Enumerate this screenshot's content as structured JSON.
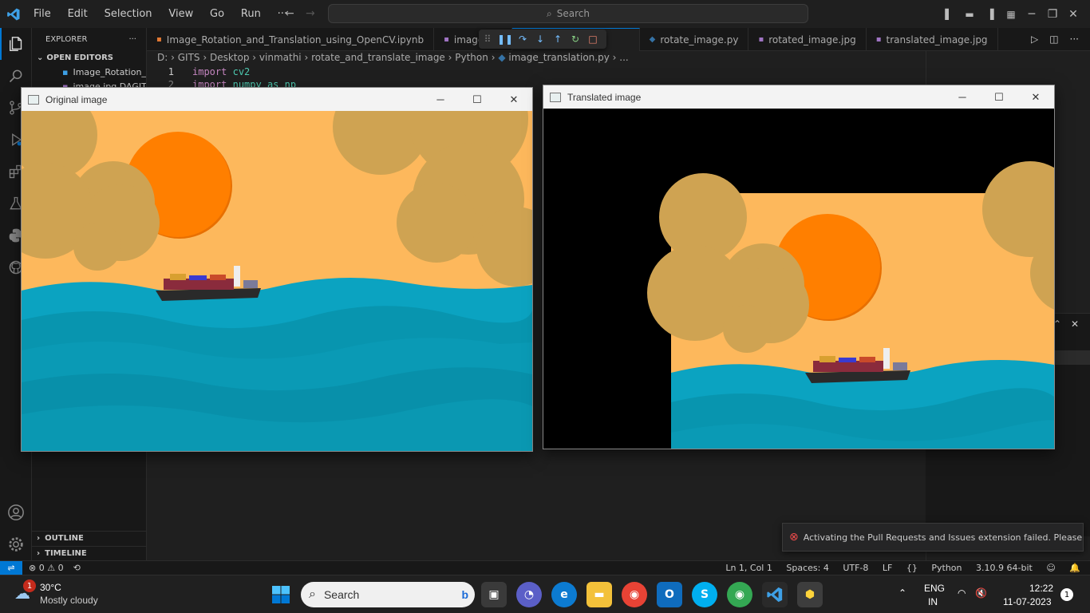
{
  "menu": {
    "items": [
      "File",
      "Edit",
      "Selection",
      "View",
      "Go",
      "Run",
      "···"
    ]
  },
  "command_center": {
    "label": "Search"
  },
  "sidebar": {
    "title": "EXPLORER",
    "open_editors": "OPEN EDITORS",
    "files": [
      "Image_Rotation_...",
      "image.jpg DAGIT..."
    ],
    "outline": "OUTLINE",
    "timeline": "TIMELINE"
  },
  "tabs": [
    {
      "label": "Image_Rotation_and_Translation_using_OpenCV.ipynb",
      "icon_color": "#e37933"
    },
    {
      "label": "image.jpg",
      "icon_color": "#a074c4"
    },
    {
      "label": "rotate_image.py",
      "icon_color": "#3572a5"
    },
    {
      "label": "rotated_image.jpg",
      "icon_color": "#a074c4"
    },
    {
      "label": "translated_image.jpg",
      "icon_color": "#a074c4"
    }
  ],
  "breadcrumb": [
    "D:",
    "GITS",
    "Desktop",
    "vinmathi",
    "rotate_and_translate_image",
    "Python",
    "image_translation.py",
    "..."
  ],
  "editor": {
    "lines": [
      {
        "num": "1",
        "kw": "import",
        "mod": "cv2"
      },
      {
        "num": "2",
        "kw": "import",
        "mod": "numpy as np"
      }
    ]
  },
  "windows": {
    "original": {
      "title": "Original image"
    },
    "translated": {
      "title": "Translated image"
    }
  },
  "status": {
    "errors": "0",
    "warnings": "0",
    "position": "Ln 1, Col 1",
    "spaces": "Spaces: 4",
    "encoding": "UTF-8",
    "eol": "LF",
    "language": "Python",
    "interpreter": "3.10.9 64-bit"
  },
  "notification": {
    "text": "Activating the Pull Requests and Issues extension failed. Please make s..."
  },
  "taskbar": {
    "weather_temp": "30°C",
    "weather_desc": "Mostly cloudy",
    "weather_badge": "1",
    "search": "Search",
    "lang1": "ENG",
    "lang2": "IN",
    "time": "12:22",
    "date": "11-07-2023",
    "notif_count": "1"
  },
  "colors": {
    "accent": "#0078d4",
    "sky": "#fdb85c",
    "sun": "#ff7f00",
    "cloud": "#d4a752",
    "sea": "#0b9bb8"
  }
}
